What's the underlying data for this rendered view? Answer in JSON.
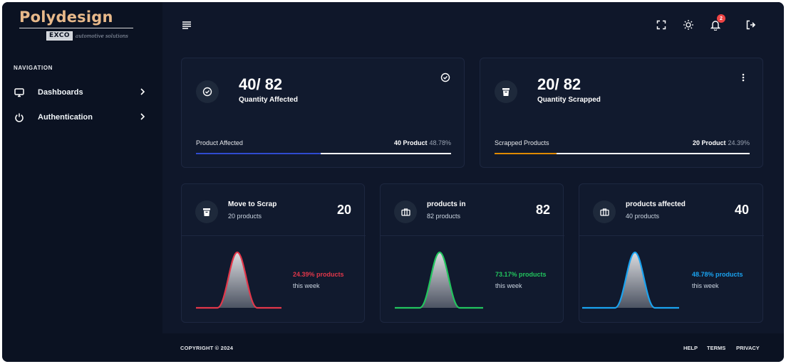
{
  "brand": {
    "title": "Polydesign",
    "exco": "EXCO",
    "tagline": "automotive solutions"
  },
  "sidebar": {
    "heading": "NAVIGATION",
    "items": [
      {
        "label": "Dashboards",
        "icon": "monitor-icon"
      },
      {
        "label": "Authentication",
        "icon": "power-icon"
      }
    ]
  },
  "header": {
    "notification_count": "2",
    "icons": [
      "menu-icon",
      "fullscreen-icon",
      "sun-icon",
      "bell-icon",
      "logout-icon"
    ]
  },
  "stats": [
    {
      "value": "40/ 82",
      "label": "Quantity Affected",
      "row_label": "Product Affected",
      "row_value": "40 Product",
      "row_pct": "48.78%",
      "progress": 0.4878,
      "bar_color": "#2f4bd0",
      "icon": "check-circle-icon",
      "action_icon": "check-circle-icon"
    },
    {
      "value": "20/ 82",
      "label": "Quantity Scrapped",
      "row_label": "Scrapped Products",
      "row_value": "20 Product",
      "row_pct": "24.39%",
      "progress": 0.2439,
      "bar_color": "#e08a00",
      "icon": "trash-icon",
      "action_icon": "more-vertical-icon"
    }
  ],
  "metrics": [
    {
      "title": "Move to Scrap",
      "sub": "20 products",
      "value": "20",
      "pct_text": "24.39% products",
      "week_text": "this week",
      "color": "#e2374a",
      "icon": "trash-icon"
    },
    {
      "title": "products in",
      "sub": "82 products",
      "value": "82",
      "pct_text": "73.17% products",
      "week_text": "this week",
      "color": "#22c55e",
      "icon": "briefcase-icon"
    },
    {
      "title": "products affected",
      "sub": "40 products",
      "value": "40",
      "pct_text": "48.78% products",
      "week_text": "this week",
      "color": "#1aa3f0",
      "icon": "briefcase-icon"
    }
  ],
  "footer": {
    "copyright": "COPYRIGHT © 2024",
    "links": [
      "HELP",
      "TERMS",
      "PRIVACY"
    ]
  }
}
